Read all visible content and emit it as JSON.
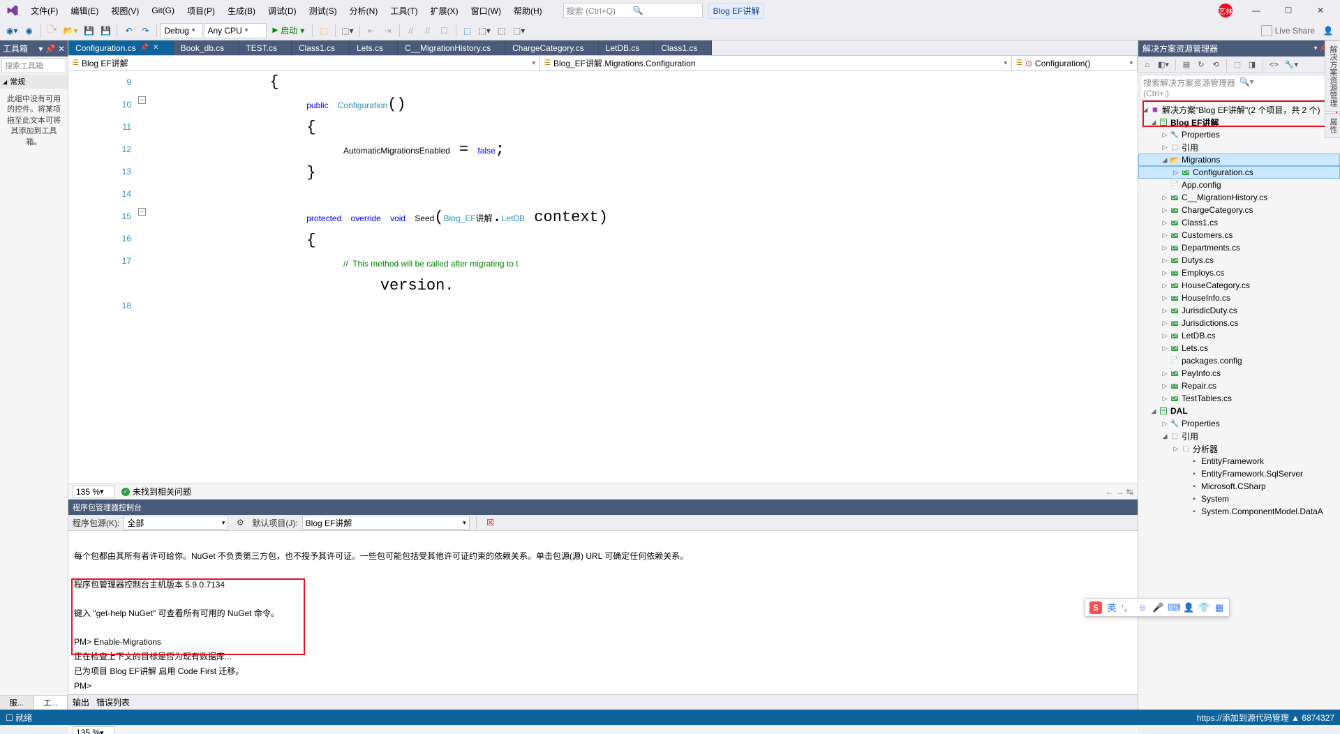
{
  "menu": {
    "file": "文件(F)",
    "edit": "编辑(E)",
    "view": "视图(V)",
    "git": "Git(G)",
    "project": "项目(P)",
    "build": "生成(B)",
    "debug": "调试(D)",
    "test": "测试(S)",
    "analyze": "分析(N)",
    "tools": "工具(T)",
    "ext": "扩展(X)",
    "window": "窗口(W)",
    "help": "帮助(H)"
  },
  "search_placeholder": "搜索 (Ctrl+Q)",
  "blog_label": "Blog EF讲解",
  "admin_badge": "艺林",
  "toolbar": {
    "config": "Debug",
    "platform": "Any CPU",
    "start": "启动"
  },
  "live_share": "Live Share",
  "toolbox": {
    "title": "工具箱",
    "search": "搜索工具箱",
    "cat": "常规",
    "msg": "此组中没有可用的控件。将某项拖至此文本可将其添加到工具箱。",
    "tab1": "服...",
    "tab2": "工..."
  },
  "doc_tabs": [
    "Configuration.cs",
    "Book_db.cs",
    "TEST.cs",
    "Class1.cs",
    "Lets.cs",
    "C__MigrationHistory.cs",
    "ChargeCategory.cs",
    "LetDB.cs",
    "Class1.cs"
  ],
  "nav": {
    "l": "Blog EF讲解",
    "m": "Blog_EF讲解.Migrations.Configuration",
    "r": "Configuration()"
  },
  "code": {
    "lines": [
      9,
      10,
      11,
      12,
      13,
      14,
      15,
      16,
      17,
      "",
      18
    ],
    "body": "            {\n                public Configuration()\n                {\n                    AutomaticMigrationsEnabled = false;\n                }\n\n                protected override void Seed(Blog_EF讲解.LetDB context)\n                {\n                    //  This method will be called after migrating to t\n                        version.\n"
  },
  "zoom": "135 %",
  "no_issue": "未找到相关问题",
  "pmc": {
    "title": "程序包管理器控制台",
    "src_label": "程序包源(K):",
    "src_val": "全部",
    "def_label": "默认项目(J):",
    "def_val": "Blog EF讲解",
    "out_line1": "每个包都由其所有者许可给你。NuGet 不负责第三方包，也不授予其许可证。一些包可能包括受其他许可证约束的依赖关系。单击包源(源) URL 可确定任何依赖关系。",
    "out_line2": "程序包管理器控制台主机版本 5.9.0.7134",
    "out_line3": "键入 \"get-help NuGet\" 可查看所有可用的 NuGet 命令。",
    "out_line4": "PM> Enable-Migrations",
    "out_line5": "正在检查上下文的目标是否为现有数据库...",
    "out_line6": "已为项目 Blog EF讲解 启用 Code First 迁移。",
    "out_line7": "PM>",
    "foot_zoom": "135 %"
  },
  "out_tabs": {
    "out": "输出",
    "err": "错误列表"
  },
  "solexp": {
    "title": "解决方案资源管理器",
    "search": "搜索解决方案资源管理器(Ctrl+;)",
    "sln": "解决方案\"Blog EF讲解\"(2 个项目，共 2 个)",
    "proj1": "Blog EF讲解",
    "props": "Properties",
    "refs": "引用",
    "migrations": "Migrations",
    "config_cs": "Configuration.cs",
    "files": [
      "App.config",
      "C__MigrationHistory.cs",
      "ChargeCategory.cs",
      "Class1.cs",
      "Customers.cs",
      "Departments.cs",
      "Dutys.cs",
      "Employs.cs",
      "HouseCategory.cs",
      "HouseInfo.cs",
      "JurisdicDuty.cs",
      "Jurisdictions.cs",
      "LetDB.cs",
      "Lets.cs",
      "packages.config",
      "PayInfo.cs",
      "Repair.cs",
      "TestTables.cs"
    ],
    "proj2": "DAL",
    "proj2_props": "Properties",
    "proj2_refs": "引用",
    "proj2_ana": "分析器",
    "proj2_asm": [
      "EntityFramework",
      "EntityFramework.SqlServer",
      "Microsoft.CSharp",
      "System",
      "System.ComponentModel.DataA"
    ]
  },
  "rail": {
    "t1": "解决方案资源管理",
    "t2": "属性"
  },
  "status": {
    "ready": "就绪",
    "right": "https://添加到源代码管理 ▲ 6874327"
  }
}
